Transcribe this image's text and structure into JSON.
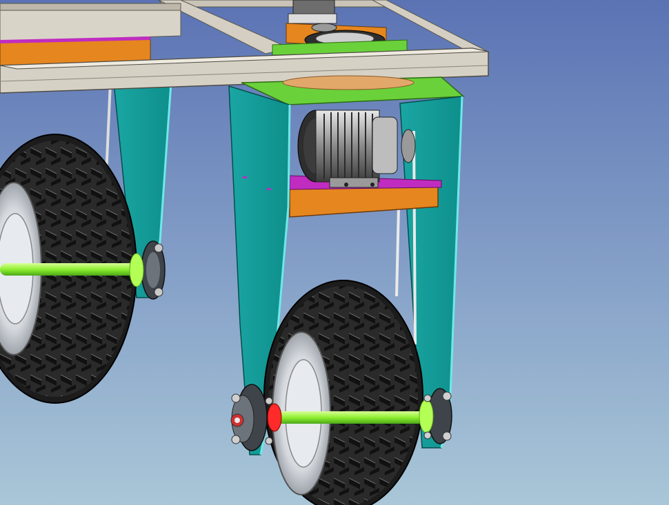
{
  "viewport": {
    "background_top": "#5b73b4",
    "background_bottom": "#a9c7d8"
  },
  "colors": {
    "frame": "#d4cfc2",
    "frame_edge": "#5a574f",
    "fork_plate": "#12a3a0",
    "fork_edge": "#63e6e6",
    "top_plate": "#6ad13a",
    "motor_mount": "#c02cc0",
    "motor_base": "#e6861f",
    "tire": "#242424",
    "rim": "#d9dde2",
    "axle": "#9bff3a",
    "hub_collar": "#ff2a2a",
    "bearing": "#555a60"
  },
  "icons": [
    "motor-icon",
    "wheel-icon",
    "gear-icon",
    "bearing-icon"
  ]
}
